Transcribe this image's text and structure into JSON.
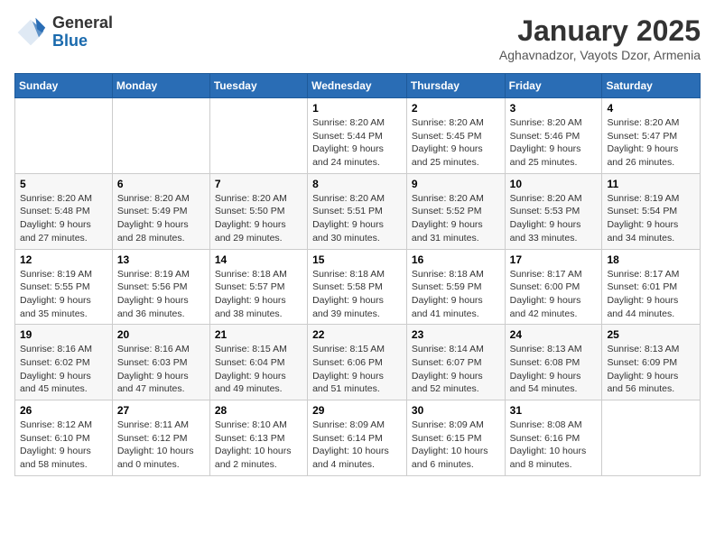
{
  "header": {
    "logo_line1": "General",
    "logo_line2": "Blue",
    "month": "January 2025",
    "location": "Aghavnadzor, Vayots Dzor, Armenia"
  },
  "weekdays": [
    "Sunday",
    "Monday",
    "Tuesday",
    "Wednesday",
    "Thursday",
    "Friday",
    "Saturday"
  ],
  "weeks": [
    [
      {
        "day": "",
        "info": ""
      },
      {
        "day": "",
        "info": ""
      },
      {
        "day": "",
        "info": ""
      },
      {
        "day": "1",
        "info": "Sunrise: 8:20 AM\nSunset: 5:44 PM\nDaylight: 9 hours\nand 24 minutes."
      },
      {
        "day": "2",
        "info": "Sunrise: 8:20 AM\nSunset: 5:45 PM\nDaylight: 9 hours\nand 25 minutes."
      },
      {
        "day": "3",
        "info": "Sunrise: 8:20 AM\nSunset: 5:46 PM\nDaylight: 9 hours\nand 25 minutes."
      },
      {
        "day": "4",
        "info": "Sunrise: 8:20 AM\nSunset: 5:47 PM\nDaylight: 9 hours\nand 26 minutes."
      }
    ],
    [
      {
        "day": "5",
        "info": "Sunrise: 8:20 AM\nSunset: 5:48 PM\nDaylight: 9 hours\nand 27 minutes."
      },
      {
        "day": "6",
        "info": "Sunrise: 8:20 AM\nSunset: 5:49 PM\nDaylight: 9 hours\nand 28 minutes."
      },
      {
        "day": "7",
        "info": "Sunrise: 8:20 AM\nSunset: 5:50 PM\nDaylight: 9 hours\nand 29 minutes."
      },
      {
        "day": "8",
        "info": "Sunrise: 8:20 AM\nSunset: 5:51 PM\nDaylight: 9 hours\nand 30 minutes."
      },
      {
        "day": "9",
        "info": "Sunrise: 8:20 AM\nSunset: 5:52 PM\nDaylight: 9 hours\nand 31 minutes."
      },
      {
        "day": "10",
        "info": "Sunrise: 8:20 AM\nSunset: 5:53 PM\nDaylight: 9 hours\nand 33 minutes."
      },
      {
        "day": "11",
        "info": "Sunrise: 8:19 AM\nSunset: 5:54 PM\nDaylight: 9 hours\nand 34 minutes."
      }
    ],
    [
      {
        "day": "12",
        "info": "Sunrise: 8:19 AM\nSunset: 5:55 PM\nDaylight: 9 hours\nand 35 minutes."
      },
      {
        "day": "13",
        "info": "Sunrise: 8:19 AM\nSunset: 5:56 PM\nDaylight: 9 hours\nand 36 minutes."
      },
      {
        "day": "14",
        "info": "Sunrise: 8:18 AM\nSunset: 5:57 PM\nDaylight: 9 hours\nand 38 minutes."
      },
      {
        "day": "15",
        "info": "Sunrise: 8:18 AM\nSunset: 5:58 PM\nDaylight: 9 hours\nand 39 minutes."
      },
      {
        "day": "16",
        "info": "Sunrise: 8:18 AM\nSunset: 5:59 PM\nDaylight: 9 hours\nand 41 minutes."
      },
      {
        "day": "17",
        "info": "Sunrise: 8:17 AM\nSunset: 6:00 PM\nDaylight: 9 hours\nand 42 minutes."
      },
      {
        "day": "18",
        "info": "Sunrise: 8:17 AM\nSunset: 6:01 PM\nDaylight: 9 hours\nand 44 minutes."
      }
    ],
    [
      {
        "day": "19",
        "info": "Sunrise: 8:16 AM\nSunset: 6:02 PM\nDaylight: 9 hours\nand 45 minutes."
      },
      {
        "day": "20",
        "info": "Sunrise: 8:16 AM\nSunset: 6:03 PM\nDaylight: 9 hours\nand 47 minutes."
      },
      {
        "day": "21",
        "info": "Sunrise: 8:15 AM\nSunset: 6:04 PM\nDaylight: 9 hours\nand 49 minutes."
      },
      {
        "day": "22",
        "info": "Sunrise: 8:15 AM\nSunset: 6:06 PM\nDaylight: 9 hours\nand 51 minutes."
      },
      {
        "day": "23",
        "info": "Sunrise: 8:14 AM\nSunset: 6:07 PM\nDaylight: 9 hours\nand 52 minutes."
      },
      {
        "day": "24",
        "info": "Sunrise: 8:13 AM\nSunset: 6:08 PM\nDaylight: 9 hours\nand 54 minutes."
      },
      {
        "day": "25",
        "info": "Sunrise: 8:13 AM\nSunset: 6:09 PM\nDaylight: 9 hours\nand 56 minutes."
      }
    ],
    [
      {
        "day": "26",
        "info": "Sunrise: 8:12 AM\nSunset: 6:10 PM\nDaylight: 9 hours\nand 58 minutes."
      },
      {
        "day": "27",
        "info": "Sunrise: 8:11 AM\nSunset: 6:12 PM\nDaylight: 10 hours\nand 0 minutes."
      },
      {
        "day": "28",
        "info": "Sunrise: 8:10 AM\nSunset: 6:13 PM\nDaylight: 10 hours\nand 2 minutes."
      },
      {
        "day": "29",
        "info": "Sunrise: 8:09 AM\nSunset: 6:14 PM\nDaylight: 10 hours\nand 4 minutes."
      },
      {
        "day": "30",
        "info": "Sunrise: 8:09 AM\nSunset: 6:15 PM\nDaylight: 10 hours\nand 6 minutes."
      },
      {
        "day": "31",
        "info": "Sunrise: 8:08 AM\nSunset: 6:16 PM\nDaylight: 10 hours\nand 8 minutes."
      },
      {
        "day": "",
        "info": ""
      }
    ]
  ]
}
